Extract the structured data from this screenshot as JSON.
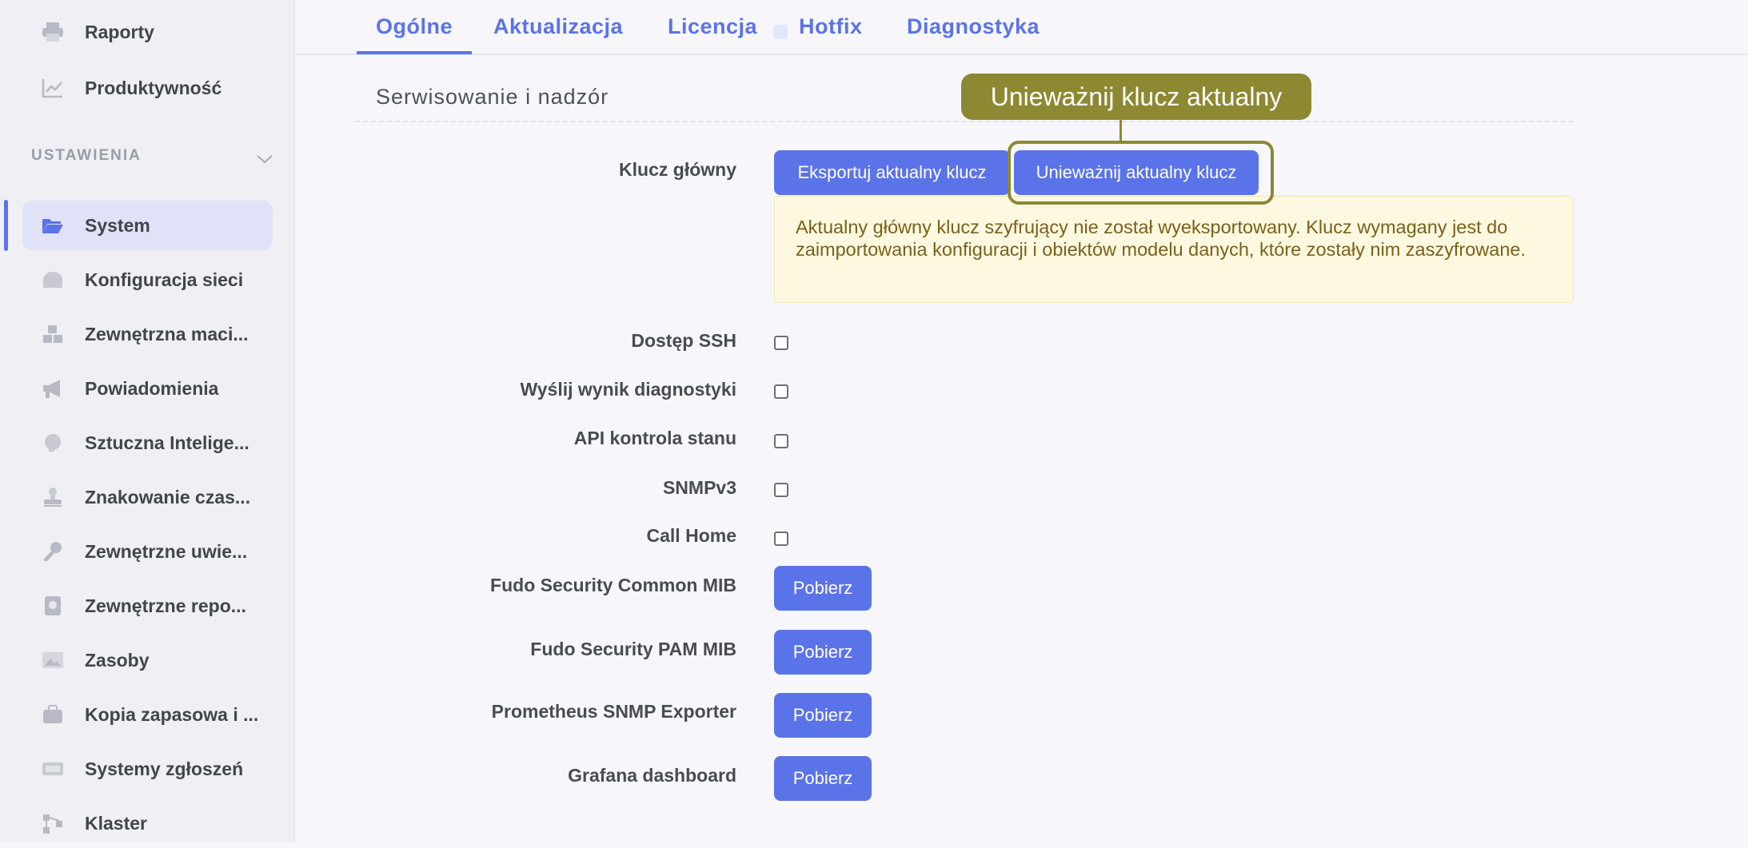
{
  "sidebar": {
    "top_items": [
      {
        "label": "Raporty",
        "icon": "printer-icon"
      },
      {
        "label": "Produktywność",
        "icon": "trend-chart-icon"
      }
    ],
    "section_label": "USTAWIENIA",
    "items": [
      {
        "label": "System",
        "icon": "folder-open-icon",
        "active": true
      },
      {
        "label": "Konfiguracja sieci",
        "icon": "network-icon"
      },
      {
        "label": "Zewnętrzna maci...",
        "icon": "cubes-icon"
      },
      {
        "label": "Powiadomienia",
        "icon": "megaphone-icon"
      },
      {
        "label": "Sztuczna Intelige...",
        "icon": "brain-icon"
      },
      {
        "label": "Znakowanie czas...",
        "icon": "stamp-icon"
      },
      {
        "label": "Zewnętrzne uwie...",
        "icon": "key-icon"
      },
      {
        "label": "Zewnętrzne repo...",
        "icon": "safe-icon"
      },
      {
        "label": "Zasoby",
        "icon": "image-icon"
      },
      {
        "label": "Kopia zapasowa i ...",
        "icon": "briefcase-icon"
      },
      {
        "label": "Systemy zgłoszeń",
        "icon": "ticket-icon"
      },
      {
        "label": "Klaster",
        "icon": "cluster-icon"
      }
    ]
  },
  "tabs": [
    "Ogólne",
    "Aktualizacja",
    "Licencja",
    "Hotfix",
    "Diagnostyka"
  ],
  "active_tab": "Ogólne",
  "section_title": "Serwisowanie i nadzór",
  "master_key": {
    "label": "Klucz główny",
    "export_button": "Eksportuj aktualny klucz",
    "revoke_button": "Unieważnij aktualny klucz",
    "warning": "Aktualny główny klucz szyfrujący nie został wyeksportowany. Klucz wymagany jest do zaimportowania konfiguracji i obiektów modelu danych, które zostały nim zaszyfrowane."
  },
  "checkbox_rows": [
    {
      "label": "Dostęp SSH",
      "checked": false
    },
    {
      "label": "Wyślij wynik diagnostyki",
      "checked": false
    },
    {
      "label": "API kontrola stanu",
      "checked": false
    },
    {
      "label": "SNMPv3",
      "checked": false
    },
    {
      "label": "Call Home",
      "checked": false
    }
  ],
  "download_rows": [
    {
      "label": "Fudo Security Common MIB",
      "button": "Pobierz"
    },
    {
      "label": "Fudo Security PAM MIB",
      "button": "Pobierz"
    },
    {
      "label": "Prometheus SNMP Exporter",
      "button": "Pobierz"
    },
    {
      "label": "Grafana dashboard",
      "button": "Pobierz"
    }
  ],
  "callout": "Unieważnij klucz aktualny",
  "colors": {
    "accent": "#5b73e8",
    "callout": "#8d8832",
    "warning_bg": "#fdf9e1",
    "warning_text": "#7b6018"
  }
}
